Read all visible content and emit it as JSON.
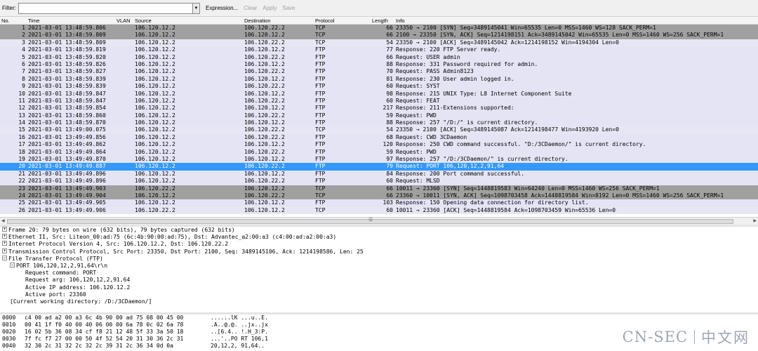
{
  "toolbar": {
    "filter_label": "Filter:",
    "filter_value": "",
    "expression_label": "Expression...",
    "clear_label": "Clear",
    "apply_label": "Apply",
    "save_label": "Save"
  },
  "columns": {
    "no": "No.",
    "time": "Time",
    "vlan": "VLAN",
    "source": "Source",
    "destination": "Destination",
    "protocol": "Protocol",
    "length": "Length",
    "info": "Info"
  },
  "colors": {
    "ftp_row": "#e4e4f5",
    "tcp_row": "#e6e6f4",
    "syn_row": "#a0a0a0",
    "selected_row": "#3399ff",
    "selected_text": "#ffffff"
  },
  "packets": [
    {
      "no": "1",
      "time": "2021-03-01 13:48:59.806",
      "src": "106.120.12.2",
      "dst": "106.120.22.2",
      "proto": "TCP",
      "len": "66",
      "info": "23350 → 2100 [SYN] Seq=3489145041 Win=65535 Len=0 MSS=1460 WS=128 SACK_PERM=1",
      "style": "syn"
    },
    {
      "no": "2",
      "time": "2021-03-01 13:48:59.809",
      "src": "106.120.12.2",
      "dst": "106.120.12.2",
      "proto": "TCP",
      "len": "66",
      "info": "2100 → 23350 [SYN, ACK] Seq=1214198151 Ack=3489145042 Win=65535 Len=0 MSS=1460 WS=256 SACK_PERM=1",
      "style": "syn"
    },
    {
      "no": "3",
      "time": "2021-03-01 13:48:59.809",
      "src": "106.120.12.2",
      "dst": "106.120.22.2",
      "proto": "TCP",
      "len": "54",
      "info": "23350 → 2100 [ACK] Seq=3489145042 Ack=1214198152 Win=4194304 Len=0",
      "style": "tcp"
    },
    {
      "no": "4",
      "time": "2021-03-01 13:48:59.819",
      "src": "106.120.12.2",
      "dst": "106.120.12.2",
      "proto": "FTP",
      "len": "77",
      "info": "Response: 220 FTP Server ready.",
      "style": "ftp"
    },
    {
      "no": "5",
      "time": "2021-03-01 13:48:59.820",
      "src": "106.120.12.2",
      "dst": "106.120.22.2",
      "proto": "FTP",
      "len": "66",
      "info": "Request: USER admin",
      "style": "ftp"
    },
    {
      "no": "6",
      "time": "2021-03-01 13:48:59.826",
      "src": "106.120.12.2",
      "dst": "106.120.12.2",
      "proto": "FTP",
      "len": "88",
      "info": "Response: 331 Password required for admin.",
      "style": "ftp"
    },
    {
      "no": "7",
      "time": "2021-03-01 13:48:59.827",
      "src": "106.120.12.2",
      "dst": "106.120.22.2",
      "proto": "FTP",
      "len": "70",
      "info": "Request: PASS Admin8123",
      "style": "ftp"
    },
    {
      "no": "8",
      "time": "2021-03-01 13:48:59.839",
      "src": "106.120.12.2",
      "dst": "106.120.12.2",
      "proto": "FTP",
      "len": "81",
      "info": "Response: 230 User admin logged in.",
      "style": "ftp"
    },
    {
      "no": "9",
      "time": "2021-03-01 13:48:59.839",
      "src": "106.120.12.2",
      "dst": "106.120.22.2",
      "proto": "FTP",
      "len": "60",
      "info": "Request: SYST",
      "style": "ftp"
    },
    {
      "no": "10",
      "time": "2021-03-01 13:48:59.847",
      "src": "106.120.12.2",
      "dst": "106.120.12.2",
      "proto": "FTP",
      "len": "98",
      "info": "Response: 215 UNIX Type: L8 Internet Component Suite",
      "style": "ftp"
    },
    {
      "no": "11",
      "time": "2021-03-01 13:48:59.847",
      "src": "106.120.12.2",
      "dst": "106.120.22.2",
      "proto": "FTP",
      "len": "60",
      "info": "Request: FEAT",
      "style": "ftp"
    },
    {
      "no": "12",
      "time": "2021-03-01 13:48:59.854",
      "src": "106.120.12.2",
      "dst": "106.120.12.2",
      "proto": "FTP",
      "len": "217",
      "info": "Response: 211-Extensions supported:",
      "style": "ftp"
    },
    {
      "no": "13",
      "time": "2021-03-01 13:48:59.860",
      "src": "106.120.12.2",
      "dst": "106.120.22.2",
      "proto": "FTP",
      "len": "59",
      "info": "Request: PWD",
      "style": "ftp"
    },
    {
      "no": "14",
      "time": "2021-03-01 13:48:59.870",
      "src": "106.120.12.2",
      "dst": "106.120.12.2",
      "proto": "FTP",
      "len": "88",
      "info": "Response: 257 \"/D:/\" is current directory.",
      "style": "ftp"
    },
    {
      "no": "15",
      "time": "2021-03-01 13:49:00.075",
      "src": "106.120.12.2",
      "dst": "106.120.22.2",
      "proto": "TCP",
      "len": "54",
      "info": "23350 → 2100 [ACK] Seq=3489145087 Ack=1214198477 Win=4193920 Len=0",
      "style": "tcp"
    },
    {
      "no": "16",
      "time": "2021-03-01 13:49:49.856",
      "src": "106.120.12.2",
      "dst": "106.120.22.2",
      "proto": "FTP",
      "len": "68",
      "info": "Request: CWD 3CDaemon",
      "style": "ftp"
    },
    {
      "no": "17",
      "time": "2021-03-01 13:49:49.862",
      "src": "106.120.12.2",
      "dst": "106.120.12.2",
      "proto": "FTP",
      "len": "120",
      "info": "Response: 250 CWD command successful. \"D:/3CDaemon/\" is current directory.",
      "style": "ftp"
    },
    {
      "no": "18",
      "time": "2021-03-01 13:49:49.864",
      "src": "106.120.12.2",
      "dst": "106.120.22.2",
      "proto": "FTP",
      "len": "59",
      "info": "Request: PWD",
      "style": "ftp"
    },
    {
      "no": "19",
      "time": "2021-03-01 13:49:49.870",
      "src": "106.120.12.2",
      "dst": "106.120.12.2",
      "proto": "FTP",
      "len": "97",
      "info": "Response: 257 \"/D:/3CDaemon/\" is current directory.",
      "style": "ftp"
    },
    {
      "no": "20",
      "time": "2021-03-01 13:49:49.887",
      "src": "106.120.12.2",
      "dst": "106.120.22.2",
      "proto": "FTP",
      "len": "79",
      "info": "Request: PORT 106,120,12,2,91,64",
      "style": "selected"
    },
    {
      "no": "21",
      "time": "2021-03-01 13:49:49.896",
      "src": "106.120.12.2",
      "dst": "106.120.12.2",
      "proto": "FTP",
      "len": "84",
      "info": "Response: 200 Port command successful.",
      "style": "ftp"
    },
    {
      "no": "22",
      "time": "2021-03-01 13:49:49.896",
      "src": "106.120.12.2",
      "dst": "106.120.22.2",
      "proto": "FTP",
      "len": "60",
      "info": "Request: MLSD",
      "style": "ftp"
    },
    {
      "no": "23",
      "time": "2021-03-01 13:49:49.903",
      "src": "106.120.22.2",
      "dst": "106.120.12.2",
      "proto": "TCP",
      "len": "66",
      "info": "10011 → 23360 [SYN] Seq=1448819583 Win=64240 Len=0 MSS=1460 WS=256 SACK_PERM=1",
      "style": "syn"
    },
    {
      "no": "24",
      "time": "2021-03-01 13:49:49.904",
      "src": "106.120.12.2",
      "dst": "106.120.22.2",
      "proto": "TCP",
      "len": "66",
      "info": "23360 → 10011 [SYN, ACK] Seq=1098703458 Ack=1448819584 Win=8192 Len=0 MSS=1460 WS=256 SACK_PERM=1",
      "style": "syn"
    },
    {
      "no": "25",
      "time": "2021-03-01 13:49:49.905",
      "src": "106.120.12.2",
      "dst": "106.120.12.2",
      "proto": "FTP",
      "len": "103",
      "info": "Response: 150 Opening data connection for directory list.",
      "style": "ftp"
    },
    {
      "no": "26",
      "time": "2021-03-01 13:49:49.906",
      "src": "106.120.22.2",
      "dst": "106.120.12.2",
      "proto": "TCP",
      "len": "60",
      "info": "10011 → 23360 [ACK] Seq=1448819584 Ack=1098703459 Win=65536 Len=0",
      "style": "tcp"
    }
  ],
  "details": [
    {
      "text": "Frame 20: 79 bytes on wire (632 bits), 79 bytes captured (632 bits)",
      "indent": 0,
      "expander": "+"
    },
    {
      "text": "Ethernet II, Src: Liteon_00:ad:75 (6c:4b:90:00:ad:75), Dst: Advantec_a2:00:a3 (c4:00:ad:a2:00:a3)",
      "indent": 0,
      "expander": "+"
    },
    {
      "text": "Internet Protocol Version 4, Src: 106.120.12.2, Dst: 106.120.22.2",
      "indent": 0,
      "expander": "+"
    },
    {
      "text": "Transmission Control Protocol, Src Port: 23350, Dst Port: 2100, Seq: 3489145106, Ack: 1214198586, Len: 25",
      "indent": 0,
      "expander": "+"
    },
    {
      "text": "File Transfer Protocol (FTP)",
      "indent": 0,
      "expander": "−"
    },
    {
      "text": "PORT 106,120,12,2,91,64\\r\\n",
      "indent": 1,
      "expander": "−"
    },
    {
      "text": "Request command: PORT",
      "indent": 3,
      "expander": ""
    },
    {
      "text": "Request arg: 106,120,12,2,91,64",
      "indent": 3,
      "expander": ""
    },
    {
      "text": "Active IP address: 106.120.12.2",
      "indent": 3,
      "expander": ""
    },
    {
      "text": "Active port: 23360",
      "indent": 3,
      "expander": ""
    },
    {
      "text": "[Current working directory: /D:/3CDaemon/]",
      "indent": 1,
      "expander": ""
    }
  ],
  "hex": [
    {
      "off": "0000",
      "bytes": "c4 00 ad a2 00 a3 6c 4b  90 00 ad 75 08 00 45 00",
      "ascii": "......lK ...u..E."
    },
    {
      "off": "0010",
      "bytes": "00 41 1f f0 40 00 40 06  00 00 6a 78 0c 02 6a 78",
      "ascii": ".A..@.@. ..jx..jx"
    },
    {
      "off": "0020",
      "bytes": "16 02 5b 36 08 34 cf f8  21 12 48 5f 33 3a 50 18",
      "ascii": "..[6.4.. !.H_3:P."
    },
    {
      "off": "0030",
      "bytes": "7f fc f7 27 00 00 50 4f  52 54 20 31 30 36 2c 31",
      "ascii": "...'..PO RT 106,1"
    },
    {
      "off": "0040",
      "bytes": "32 30 2c 31 32 2c 32 2c  39 31 2c 36 34 0d 0a",
      "ascii": "20,12,2, 91,64.."
    }
  ],
  "watermark": {
    "left": "CN-SEC",
    "right": "中文网"
  }
}
